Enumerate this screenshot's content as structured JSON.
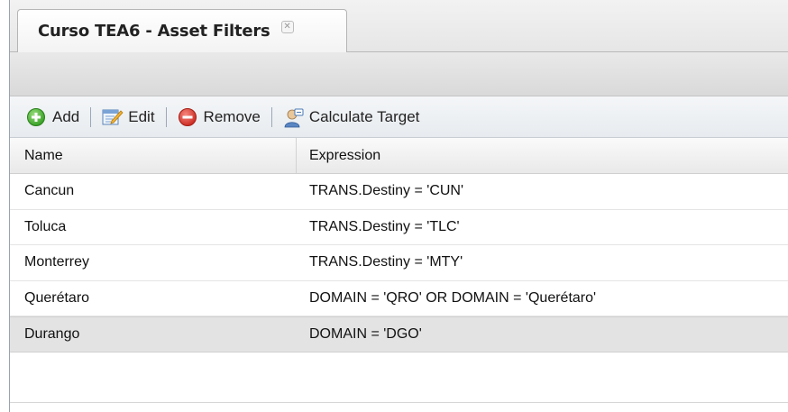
{
  "tab": {
    "title": "Curso TEA6 - Asset Filters",
    "close_glyph": "✕"
  },
  "toolbar": {
    "add_label": "Add",
    "edit_label": "Edit",
    "remove_label": "Remove",
    "calculate_label": "Calculate Target",
    "icons": [
      "add-icon",
      "edit-icon",
      "remove-icon",
      "calculate-target-icon"
    ]
  },
  "grid": {
    "columns": [
      "Name",
      "Expression"
    ],
    "rows": [
      {
        "name": "Cancun",
        "expression": "TRANS.Destiny = 'CUN'"
      },
      {
        "name": "Toluca",
        "expression": "TRANS.Destiny = 'TLC'"
      },
      {
        "name": "Monterrey",
        "expression": "TRANS.Destiny = 'MTY'"
      },
      {
        "name": "Querétaro",
        "expression": "DOMAIN = 'QRO' OR DOMAIN = 'Querétaro'"
      },
      {
        "name": "Durango",
        "expression": "DOMAIN = 'DGO'"
      }
    ],
    "selected_row": 4
  },
  "colors": {
    "add": "#3fae2a",
    "remove": "#d9342b",
    "accent": "#4a78b5"
  }
}
